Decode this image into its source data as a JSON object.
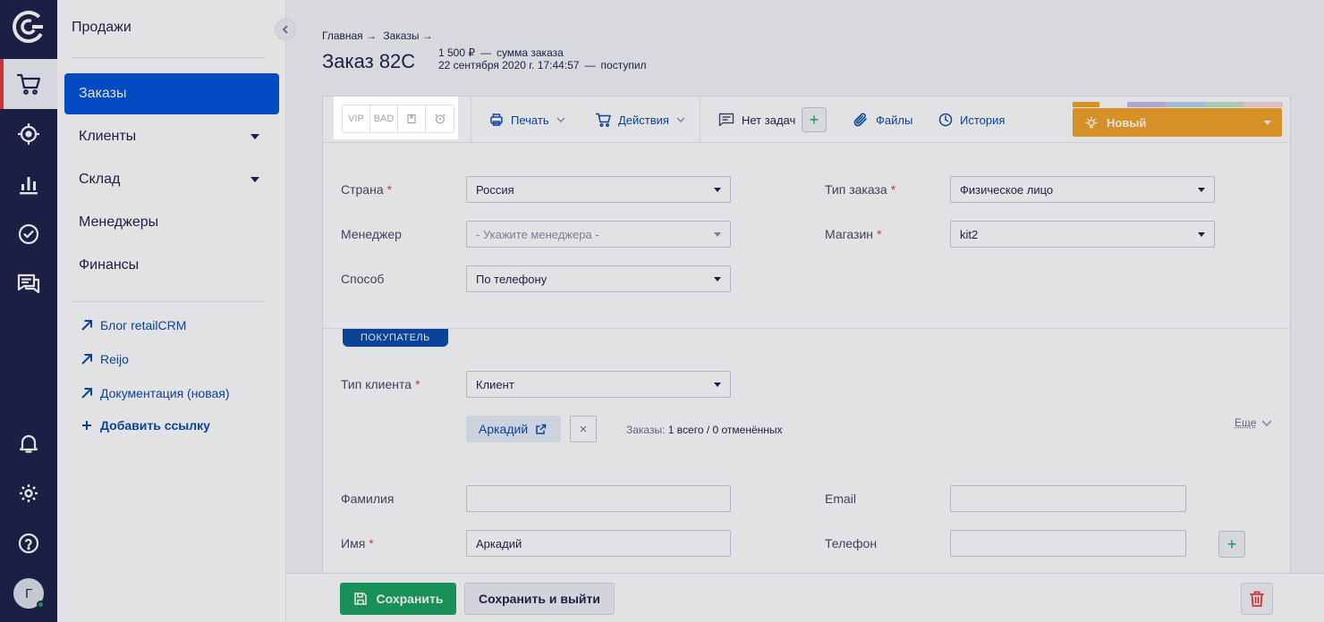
{
  "sidebar": {
    "title": "Продажи",
    "nav": [
      {
        "label": "Заказы"
      },
      {
        "label": "Клиенты"
      },
      {
        "label": "Склад"
      },
      {
        "label": "Менеджеры"
      },
      {
        "label": "Финансы"
      }
    ],
    "links": [
      {
        "label": "Блог retailCRM"
      },
      {
        "label": "Reijo"
      },
      {
        "label": "Документация (новая)"
      },
      {
        "label": "Добавить ссылку"
      }
    ]
  },
  "user": {
    "initial": "Г"
  },
  "breadcrumb": {
    "home": "Главная →",
    "orders": "Заказы →"
  },
  "order": {
    "title": "Заказ 82C",
    "amount": "1 500 ₽",
    "amount_label": "сумма заказа",
    "date": "22 сентября 2020 г. 17:44:57",
    "date_label": "поступил"
  },
  "toolbar": {
    "tags": [
      "VIP",
      "BAD"
    ],
    "print": "Печать",
    "actions": "Действия",
    "tasks": "Нет задач",
    "files": "Файлы",
    "history": "История",
    "status": "Новый",
    "status_colors": [
      "#f1a226",
      "#ffffff",
      "#c9b8e8",
      "#b8d8f0",
      "#bfe3c6",
      "#f6d5d5"
    ]
  },
  "form": {
    "country": {
      "label": "Страна",
      "value": "Россия"
    },
    "order_type": {
      "label": "Тип заказа",
      "value": "Физическое лицо"
    },
    "manager": {
      "label": "Менеджер",
      "placeholder": "- Укажите менеджера -"
    },
    "shop": {
      "label": "Магазин",
      "value": "kit2"
    },
    "method": {
      "label": "Способ",
      "value": "По телефону"
    },
    "section": "ПОКУПАТЕЛЬ",
    "client_type": {
      "label": "Тип клиента",
      "value": "Клиент"
    },
    "client_name": "Аркадий",
    "orders_label": "Заказы:",
    "orders_value": "1 всего / 0 отменённых",
    "more": "Еще",
    "last_name": {
      "label": "Фамилия",
      "value": ""
    },
    "email": {
      "label": "Email",
      "value": ""
    },
    "first_name": {
      "label": "Имя",
      "value": "Аркадий"
    },
    "phone": {
      "label": "Телефон",
      "value": ""
    }
  },
  "footer": {
    "save": "Сохранить",
    "save_exit": "Сохранить и выйти"
  }
}
